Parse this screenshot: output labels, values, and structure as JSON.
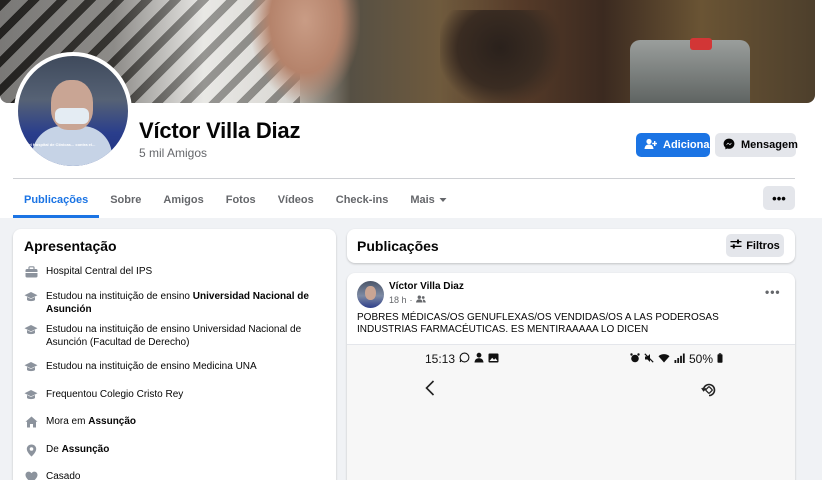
{
  "profile": {
    "name": "Víctor Villa Diaz",
    "friends": "5 mil Amigos",
    "avatar_caption": "del Hospital de Clínicas... contra el..."
  },
  "actions": {
    "add_label": "Adicionar",
    "message_label": "Mensagem"
  },
  "tabs": [
    {
      "label": "Publicações",
      "active": true
    },
    {
      "label": "Sobre"
    },
    {
      "label": "Amigos"
    },
    {
      "label": "Fotos"
    },
    {
      "label": "Vídeos"
    },
    {
      "label": "Check-ins"
    },
    {
      "label": "Mais"
    }
  ],
  "more_button": "•••",
  "intro": {
    "title": "Apresentação",
    "items": [
      {
        "icon": "work-icon",
        "prefix": "Hospital Central del IPS",
        "bold": ""
      },
      {
        "icon": "education-icon",
        "prefix": "Estudou na instituição de ensino ",
        "bold": "Universidad Nacional de Asunción"
      },
      {
        "icon": "education-icon",
        "prefix": "Estudou na instituição de ensino Universidad Nacional de Asunción (Facultad de Derecho)",
        "bold": ""
      },
      {
        "icon": "education-icon",
        "prefix": "Estudou na instituição de ensino Medicina UNA",
        "bold": ""
      },
      {
        "icon": "education-icon",
        "prefix": "Frequentou Colegio Cristo Rey",
        "bold": ""
      },
      {
        "icon": "home-icon",
        "prefix": "Mora em ",
        "bold": "Assunção"
      },
      {
        "icon": "location-pin-icon",
        "prefix": "De ",
        "bold": "Assunção"
      },
      {
        "icon": "heart-icon",
        "prefix": "Casado",
        "bold": ""
      }
    ]
  },
  "publications": {
    "title": "Publicações",
    "filter_label": "Filtros"
  },
  "post": {
    "author": "Víctor Villa Diaz",
    "time": "18 h",
    "text": "POBRES MÉDICAS/OS GENUFLEXAS/OS VENDIDAS/OS A LAS PODEROSAS INDUSTRIAS FARMACÉUTICAS. ES MENTIRAAAAA LO DICEN",
    "screenshot": {
      "time": "15:13",
      "battery": "50%"
    }
  },
  "colors": {
    "accent": "#1b74e4",
    "page_bg": "#f0f2f5",
    "secondary_text": "#65676b"
  }
}
